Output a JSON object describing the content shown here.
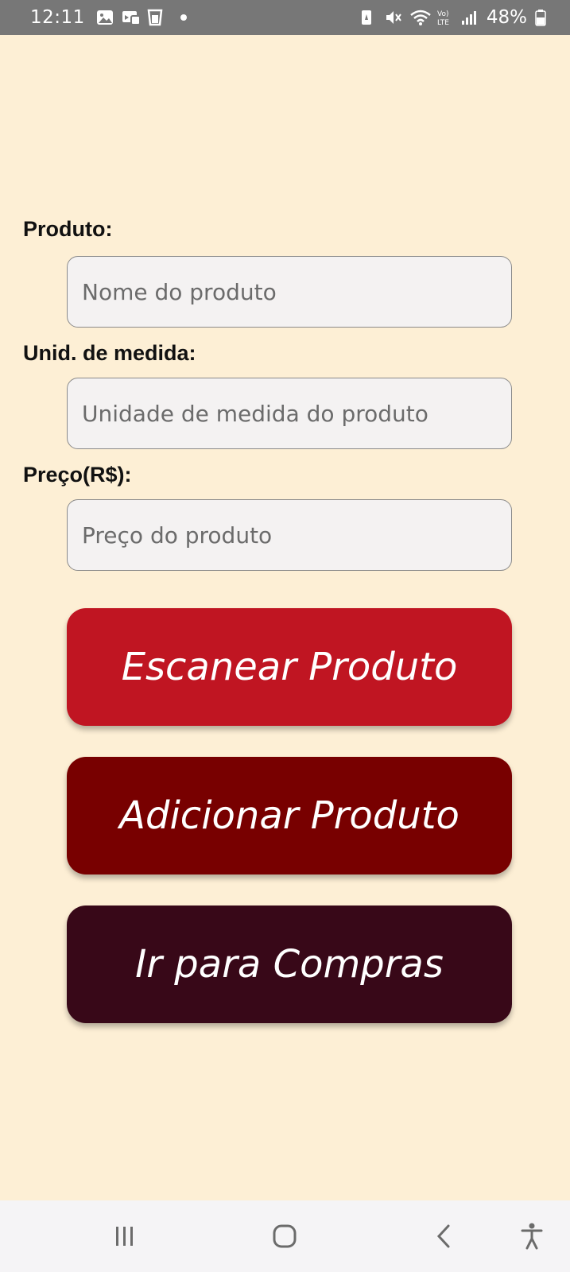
{
  "status_bar": {
    "time": "12:11",
    "battery": "48%",
    "notification_icons": [
      "gallery-icon",
      "screen-mirror-icon",
      "cup-icon",
      "dot-icon"
    ],
    "system_icons": [
      "battery-saver-icon",
      "mute-icon",
      "wifi-icon",
      "volte-icon",
      "signal-icon",
      "battery-icon"
    ]
  },
  "form": {
    "product": {
      "label": "Produto:",
      "placeholder": "Nome do produto",
      "value": ""
    },
    "unit": {
      "label": "Unid. de medida:",
      "placeholder": "Unidade de medida do produto",
      "value": ""
    },
    "price": {
      "label": "Preço(R$):",
      "placeholder": "Preço do produto",
      "value": ""
    }
  },
  "buttons": {
    "scan": {
      "label": "Escanear Produto",
      "color": "#c01522"
    },
    "add": {
      "label": "Adicionar Produto",
      "color": "#780000"
    },
    "go_shopping": {
      "label": "Ir para Compras",
      "color": "#380818"
    }
  },
  "colors": {
    "background": "#fdefd5",
    "status_bar": "#777777",
    "nav_bar": "#f5f4f6"
  },
  "nav_bar": {
    "icons": [
      "recent-apps-icon",
      "home-icon",
      "back-icon",
      "accessibility-icon"
    ]
  }
}
